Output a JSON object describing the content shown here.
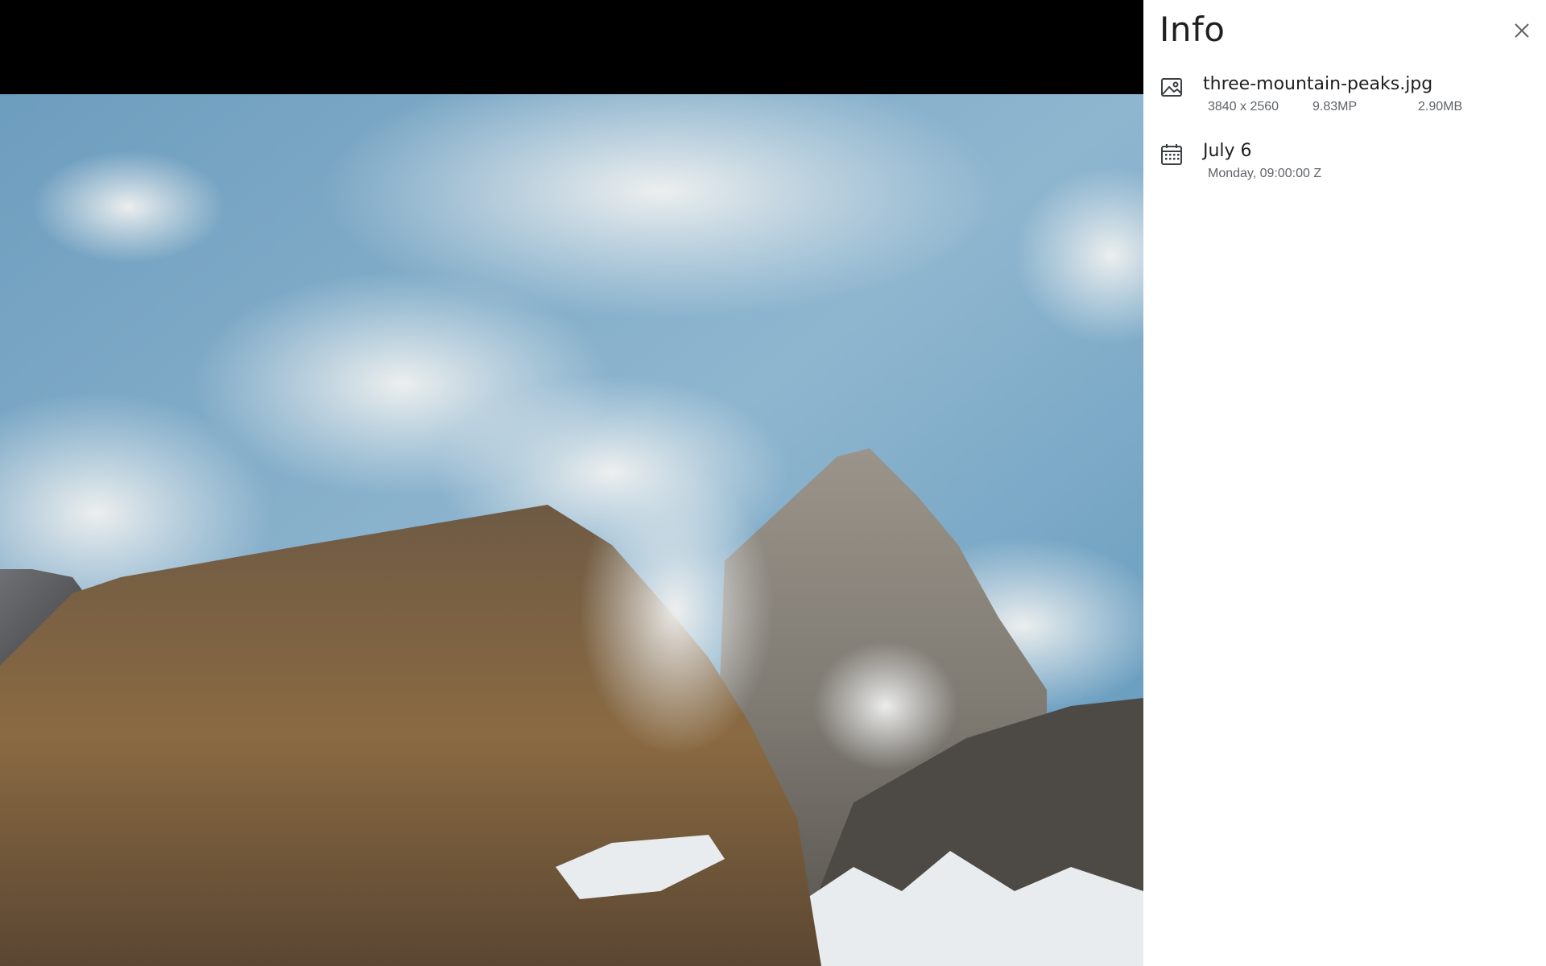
{
  "panel": {
    "title": "Info",
    "close_icon": "close-icon"
  },
  "file": {
    "icon": "image-icon",
    "name": "three-mountain-peaks.jpg",
    "dimensions": "3840 x 2560",
    "megapixels": "9.83MP",
    "size": "2.90MB"
  },
  "date": {
    "icon": "calendar-icon",
    "label": "July 6",
    "detail": "Monday, 09:00:00 Z"
  },
  "colors": {
    "viewer_background": "#000000",
    "panel_background": "#ffffff",
    "primary_text": "#1f1f1f",
    "secondary_text": "#5f6368"
  }
}
